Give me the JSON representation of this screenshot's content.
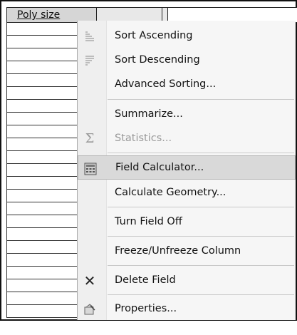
{
  "table": {
    "field_header": "Poly size"
  },
  "menu": {
    "items": [
      {
        "label": "Sort Ascending",
        "icon": "sort-ascending-icon",
        "enabled": true
      },
      {
        "label": "Sort Descending",
        "icon": "sort-descending-icon",
        "enabled": true
      },
      {
        "label": "Advanced Sorting...",
        "icon": "",
        "enabled": true
      },
      {
        "label": "Summarize...",
        "icon": "",
        "enabled": true
      },
      {
        "label": "Statistics...",
        "icon": "sigma-icon",
        "enabled": false
      },
      {
        "label": "Field Calculator...",
        "icon": "calculator-icon",
        "enabled": true,
        "highlighted": true
      },
      {
        "label": "Calculate Geometry...",
        "icon": "",
        "enabled": true
      },
      {
        "label": "Turn Field Off",
        "icon": "",
        "enabled": true
      },
      {
        "label": "Freeze/Unfreeze Column",
        "icon": "",
        "enabled": true
      },
      {
        "label": "Delete Field",
        "icon": "delete-x-icon",
        "enabled": true
      },
      {
        "label": "Properties...",
        "icon": "properties-icon",
        "enabled": true
      }
    ]
  },
  "colors": {
    "highlight_bg": "#d9d9d9",
    "disabled_text": "#9a9a9a"
  }
}
